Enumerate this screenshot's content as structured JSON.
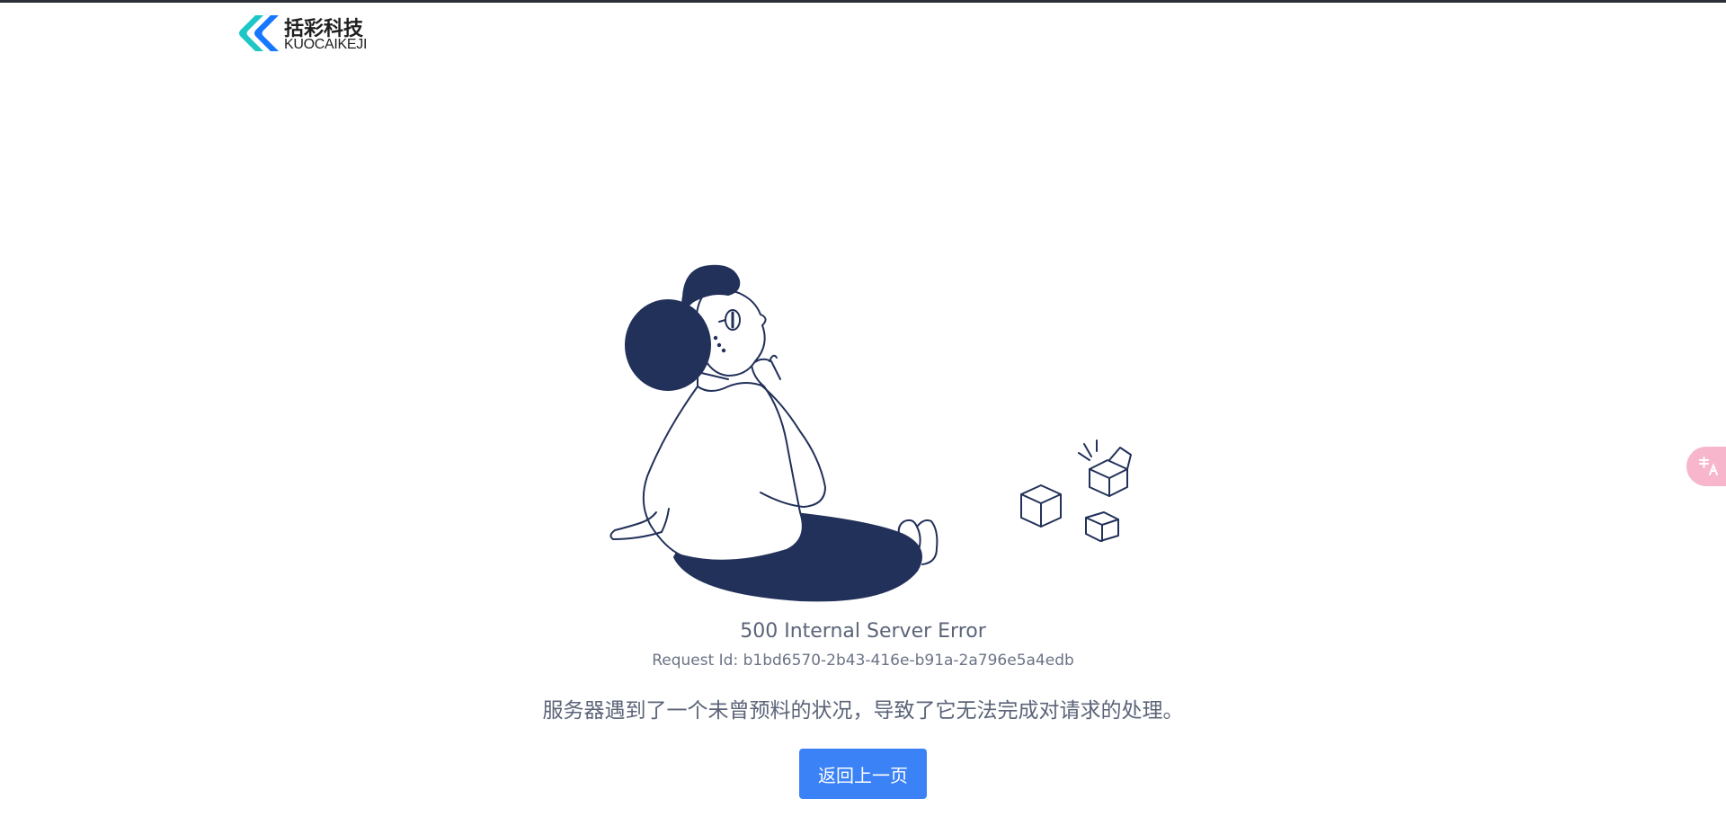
{
  "header": {
    "logo_cn": "括彩科技",
    "logo_en": "KUOCAIKEJI"
  },
  "error": {
    "title": "500 Internal Server Error",
    "request_id": "Request Id: b1bd6570-2b43-416e-b91a-2a796e5a4edb",
    "message": "服务器遇到了一个未曾预料的状况，导致了它无法完成对请求的处理。"
  },
  "actions": {
    "back_label": "返回上一页"
  },
  "icons": {
    "translate": "translate-icon"
  },
  "colors": {
    "primary": "#3b82f6",
    "navy": "#22315a",
    "text": "#5b6478",
    "logo_teal": "#1ec6c6",
    "logo_blue": "#1677ff",
    "fab_pink": "#f7b6cc"
  }
}
